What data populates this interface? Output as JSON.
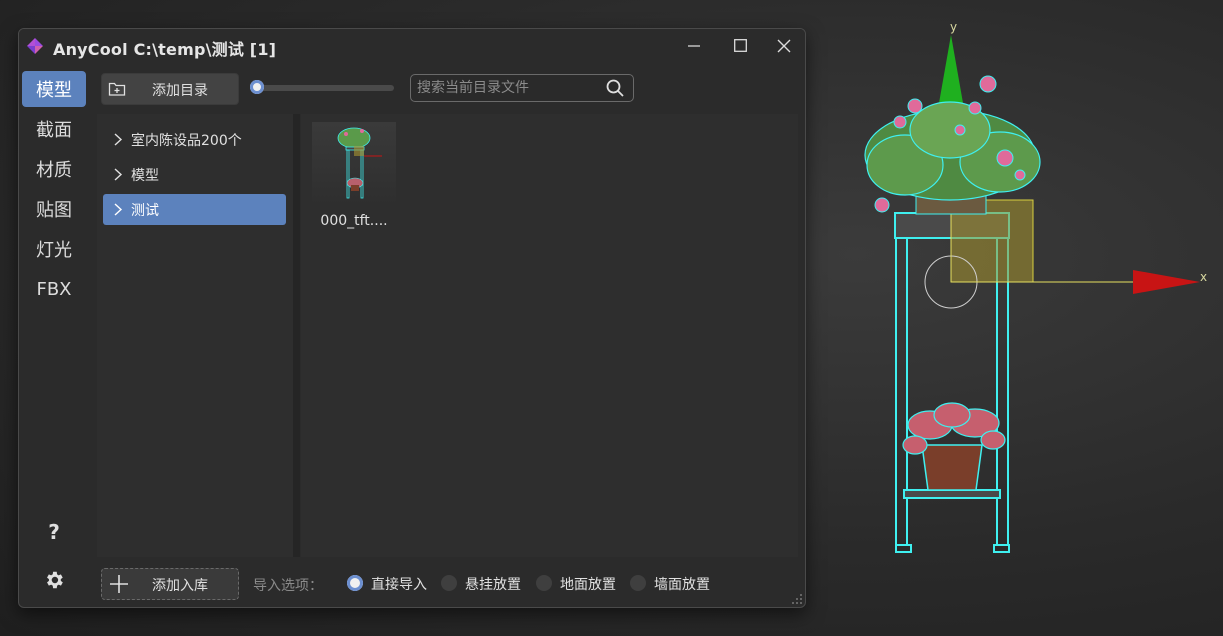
{
  "window": {
    "title": "AnyCool C:\\temp\\测试  [1]",
    "controls": [
      "minimize",
      "maximize",
      "close"
    ]
  },
  "sidebar": {
    "items": [
      {
        "label": "模型",
        "active": true
      },
      {
        "label": "截面",
        "active": false
      },
      {
        "label": "材质",
        "active": false
      },
      {
        "label": "贴图",
        "active": false
      },
      {
        "label": "灯光",
        "active": false
      },
      {
        "label": "FBX",
        "active": false
      }
    ],
    "help_label": "?",
    "settings_icon": "gear-icon"
  },
  "toolbar": {
    "add_dir_label": "添加目录",
    "add_dir_icon": "folder-add-icon",
    "thumb_size_level": 0.0,
    "search_placeholder": "搜索当前目录文件",
    "search_icon": "search-icon"
  },
  "tree": {
    "items": [
      {
        "label": "室内陈设品200个",
        "active": false
      },
      {
        "label": "模型",
        "active": false
      },
      {
        "label": "测试",
        "active": true
      }
    ]
  },
  "files": [
    {
      "name": "000_tft...."
    }
  ],
  "bottom": {
    "add_lib_label": "添加入库",
    "import_options_label": "导入选项：",
    "options": [
      {
        "label": "直接导入",
        "checked": true
      },
      {
        "label": "悬挂放置",
        "checked": false
      },
      {
        "label": "地面放置",
        "checked": false
      },
      {
        "label": "墙面放置",
        "checked": false
      }
    ]
  },
  "viewport": {
    "axis_y_label": "y",
    "axis_x_label": "x",
    "colors": {
      "wire": "#3ff0f0",
      "y_axis": "#1fb01f",
      "x_axis": "#c81414",
      "gizmo": "#b3a23a"
    }
  }
}
